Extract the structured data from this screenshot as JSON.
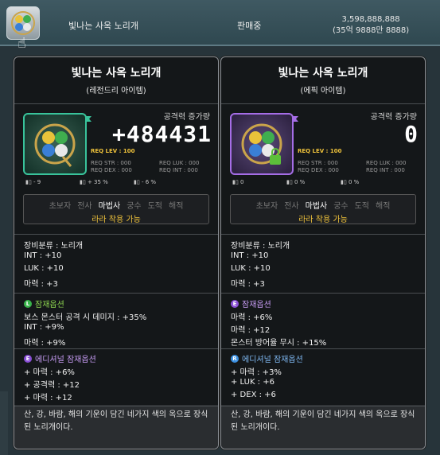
{
  "top": {
    "item_name": "빛나는 사옥 노리개",
    "status": "판매중",
    "price_line1": "3,598,888,888",
    "price_line2": "(35억 9888만 8888)",
    "icon": "jewel-ornament-icon"
  },
  "panels": [
    {
      "title": "빛나는 사옥 노리개",
      "grade": "(레전드리 아이템)",
      "stat_label": "공격력 증가량",
      "stat_value": "+484431",
      "req_lev": "REQ LEV : 100",
      "req": [
        "REQ STR : 000",
        "REQ LUK : 000",
        "REQ DEX : 000",
        "REQ INT : 000"
      ],
      "mini_stats": [
        "- 9",
        "+ 35 %",
        "- 6 %"
      ],
      "classes": [
        "초보자",
        "전사",
        "마법사",
        "궁수",
        "도적",
        "해적"
      ],
      "active_class": "마법사",
      "wear_text": "라라 착용 가능",
      "base": [
        "장비분류 : 노리개",
        "INT : +10",
        "LUK : +10",
        "마력 : +3"
      ],
      "potential_title": "잠재옵션",
      "potential_badge": "L",
      "potential_color": "#38b34a",
      "potential": [
        "보스 몬스터 공격 시 데미지 : +35%",
        "INT : +9%",
        "마력 : +9%"
      ],
      "additional_title": "에디셔널 잠재옵션",
      "additional_badge": "E",
      "additional_color": "#8a4fd6",
      "additional": [
        "+ 마력 : +6%",
        "+ 공격력 : +12",
        "+ 마력 : +12"
      ],
      "description": "산, 강, 바람, 해의 기운이 담긴 네가지 색의 옥으로 장식된 노리개이다."
    },
    {
      "title": "빛나는 사옥 노리개",
      "grade": "(에픽 아이템)",
      "stat_label": "공격력 증가량",
      "stat_value": "0",
      "req_lev": "REQ LEV : 100",
      "req": [
        "REQ STR : 000",
        "REQ LUK : 000",
        "REQ DEX : 000",
        "REQ INT : 000"
      ],
      "mini_stats": [
        "0",
        "0 %",
        "0 %"
      ],
      "classes": [
        "초보자",
        "전사",
        "마법사",
        "궁수",
        "도적",
        "해적"
      ],
      "active_class": "마법사",
      "wear_text": "라라 착용 가능",
      "base": [
        "장비분류 : 노리개",
        "INT : +10",
        "LUK : +10",
        "마력 : +3"
      ],
      "potential_title": "잠재옵션",
      "potential_badge": "E",
      "potential_color": "#8a4fd6",
      "potential": [
        "마력 : +6%",
        "마력 : +12",
        "몬스터 방어율 무시 : +15%"
      ],
      "additional_title": "에디셔널 잠재옵션",
      "additional_badge": "R",
      "additional_color": "#3a8fe0",
      "additional": [
        "+ 마력 : +3%",
        "+ LUK : +6",
        "+ DEX : +6"
      ],
      "description": "산, 강, 바람, 해의 기운이 담긴 네가지 색의 옥으로 장식된 노리개이다."
    }
  ]
}
